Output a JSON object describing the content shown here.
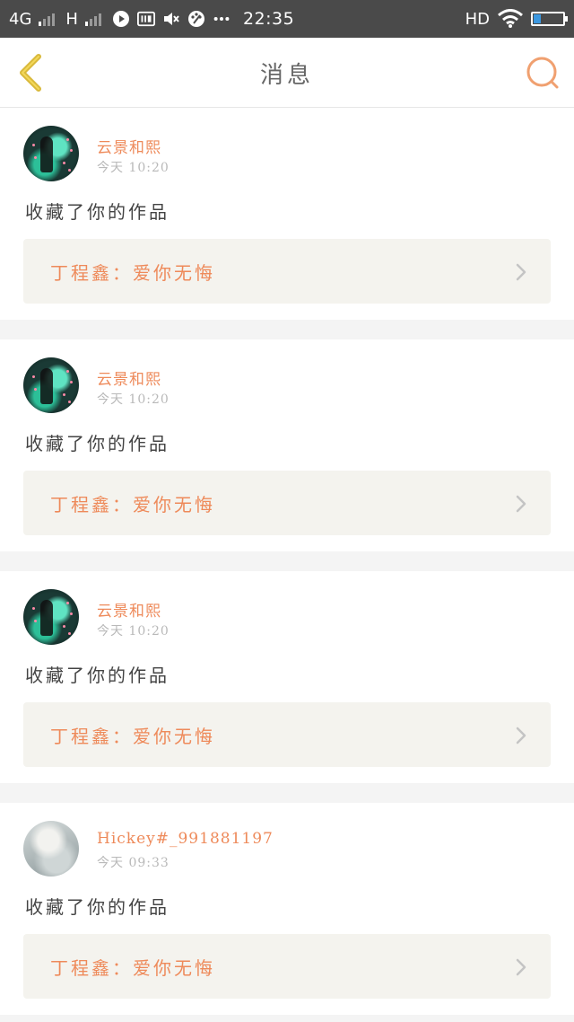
{
  "status_bar": {
    "network_primary": "4G",
    "network_secondary": "H",
    "time": "22:35",
    "hd_label": "HD",
    "battery_level": 0.25,
    "icons": [
      "play-circle-icon",
      "iqiyi-icon",
      "muted-speaker-icon",
      "palette-icon",
      "more-dots-icon",
      "wifi-icon",
      "battery-icon"
    ]
  },
  "header": {
    "title": "消息",
    "back_icon": "chevron-left-icon",
    "search_icon": "search-icon"
  },
  "colors": {
    "accent": "#ee8a5a",
    "back_icon": "#d9b93a",
    "card_link_bg": "#f4f3ee",
    "page_bg": "#f4f4f4"
  },
  "messages": [
    {
      "user": "云景和熙",
      "time": "今天  10:20",
      "action": "收藏了你的作品",
      "work": "丁程鑫：爱你无悔",
      "avatar": "avatar-style-a"
    },
    {
      "user": "云景和熙",
      "time": "今天  10:20",
      "action": "收藏了你的作品",
      "work": "丁程鑫：爱你无悔",
      "avatar": "avatar-style-a"
    },
    {
      "user": "云景和熙",
      "time": "今天  10:20",
      "action": "收藏了你的作品",
      "work": "丁程鑫：爱你无悔",
      "avatar": "avatar-style-a"
    },
    {
      "user": "Hickey#_991881197",
      "time": "今天  09:33",
      "action": "收藏了你的作品",
      "work": "丁程鑫：爱你无悔",
      "avatar": "avatar-style-b"
    }
  ]
}
